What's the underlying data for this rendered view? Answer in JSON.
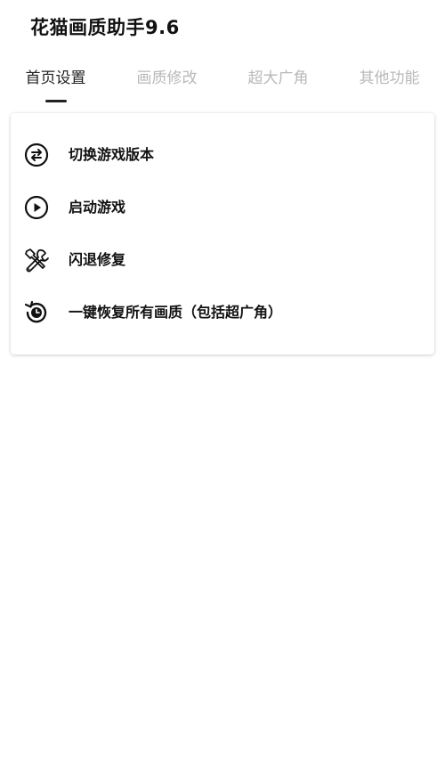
{
  "app": {
    "title": "花猫画质助手9.6"
  },
  "tabs": [
    {
      "label": "首页设置",
      "active": true
    },
    {
      "label": "画质修改",
      "active": false
    },
    {
      "label": "超大广角",
      "active": false
    },
    {
      "label": "其他功能",
      "active": false
    }
  ],
  "menu": {
    "items": [
      {
        "label": "切换游戏版本",
        "icon": "swap-icon"
      },
      {
        "label": "启动游戏",
        "icon": "play-icon"
      },
      {
        "label": "闪退修复",
        "icon": "tools-icon"
      },
      {
        "label": "一键恢复所有画质（包括超广角）",
        "icon": "restore-icon"
      }
    ]
  },
  "colors": {
    "text": "#111111",
    "tab_inactive": "#b9b9b9",
    "tab_active": "#222222",
    "background": "#ffffff"
  }
}
